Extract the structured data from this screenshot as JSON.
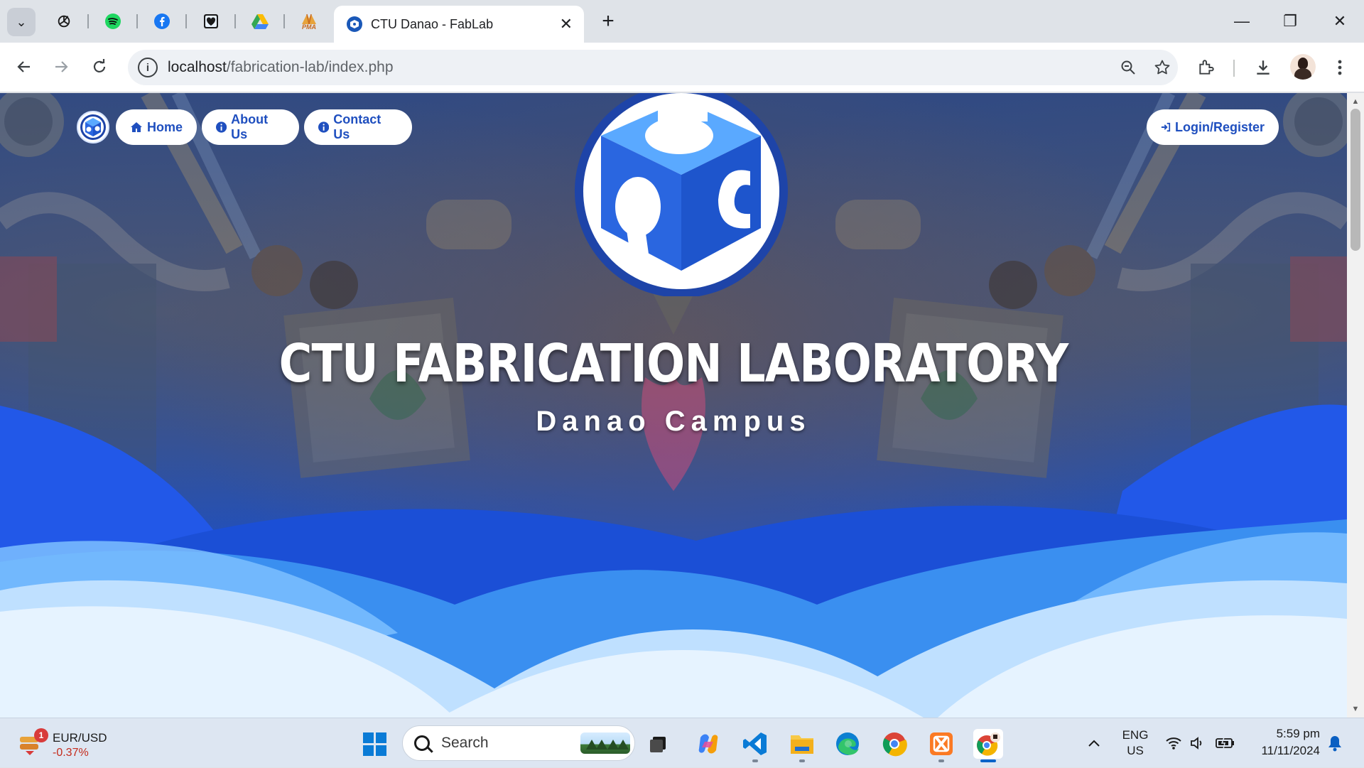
{
  "browser": {
    "tab_search_icon": "chevron-down-icon",
    "pinned_tabs": [
      {
        "name": "chatgpt",
        "icon": "openai-icon",
        "color": "#1a1a1a"
      },
      {
        "name": "spotify",
        "icon": "spotify-icon",
        "color": "#1ed760"
      },
      {
        "name": "facebook",
        "icon": "facebook-icon",
        "color": "#1877f2"
      },
      {
        "name": "heart-app",
        "icon": "heart-icon",
        "color": "#1a1a1a"
      },
      {
        "name": "google-drive",
        "icon": "drive-icon",
        "color": "#34a853"
      },
      {
        "name": "pma",
        "icon": "pma-icon",
        "label": "PMA",
        "color": "#c8691e"
      }
    ],
    "active_tab": {
      "title": "CTU Danao - FabLab",
      "favicon": "fablab-icon",
      "close_label": "✕"
    },
    "new_tab_label": "+",
    "window_controls": {
      "minimize": "—",
      "restore": "❐",
      "close": "✕"
    },
    "url": {
      "host": "localhost",
      "path": "/fabrication-lab/index.php"
    }
  },
  "site": {
    "nav": [
      {
        "key": "home",
        "label": "Home",
        "icon": "home-icon"
      },
      {
        "key": "about",
        "label": "About Us",
        "icon": "info-icon"
      },
      {
        "key": "contact",
        "label": "Contact Us",
        "icon": "info-icon"
      }
    ],
    "login_label": "Login/Register",
    "hero_title": "CTU FABRICATION LABORATORY",
    "hero_subtitle": "Danao Campus",
    "colors": {
      "primary": "#1f4fbf",
      "light_blue": "#5aa9ff",
      "wave_light": "#e9f4ff"
    }
  },
  "taskbar": {
    "widget": {
      "pair": "EUR/USD",
      "change": "-0.37%",
      "badge": "1"
    },
    "search_label": "Search",
    "apps": [
      "windows-start",
      "search",
      "task-view",
      "copilot",
      "vscode",
      "file-explorer",
      "edge",
      "chrome",
      "xampp",
      "chrome-profile"
    ],
    "tray": {
      "language": "ENG",
      "region": "US",
      "time": "5:59 pm",
      "date": "11/11/2024"
    }
  }
}
